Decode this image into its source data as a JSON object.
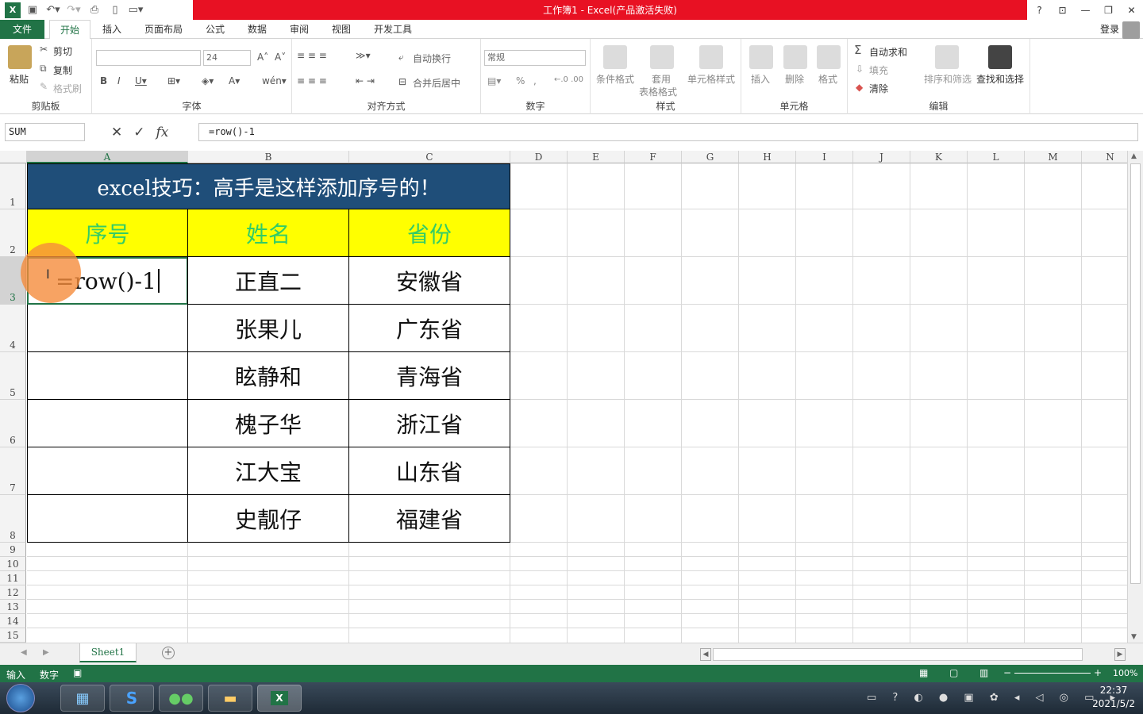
{
  "app": {
    "title": "工作簿1 - Excel(产品激活失败)"
  },
  "window": {
    "help": "?",
    "ribbon_display": "⊡",
    "minimize": "—",
    "restore": "❐",
    "close": "✕"
  },
  "tabs": [
    "文件",
    "开始",
    "插入",
    "页面布局",
    "公式",
    "数据",
    "审阅",
    "视图",
    "开发工具"
  ],
  "account": {
    "login": "登录"
  },
  "ribbon": {
    "clipboard": {
      "paste": "粘贴",
      "cut": "剪切",
      "copy": "复制",
      "format_painter": "格式刷",
      "label": "剪贴板"
    },
    "font": {
      "font_name": "",
      "font_size": "24",
      "label": "字体"
    },
    "alignment": {
      "wrap": "自动换行",
      "merge": "合并后居中",
      "label": "对齐方式"
    },
    "number": {
      "format": "常规",
      "label": "数字"
    },
    "styles": {
      "conditional": "条件格式",
      "table1": "套用",
      "table2": "表格格式",
      "cell_styles": "单元格样式",
      "label": "样式"
    },
    "cells": {
      "insert": "插入",
      "delete": "删除",
      "format": "格式",
      "label": "单元格"
    },
    "editing": {
      "autosum": "自动求和",
      "fill": "填充",
      "clear": "清除",
      "sort": "排序和筛选",
      "find": "查找和选择",
      "label": "编辑"
    }
  },
  "formula_bar": {
    "name_box": "SUM",
    "formula": "=row()-1",
    "fx": "fx"
  },
  "columns": [
    "A",
    "B",
    "C",
    "D",
    "E",
    "F",
    "G",
    "H",
    "I",
    "J",
    "K",
    "L",
    "M",
    "N"
  ],
  "rows": [
    "1",
    "2",
    "3",
    "4",
    "5",
    "6",
    "7",
    "8",
    "9",
    "10",
    "11",
    "12",
    "13",
    "14",
    "15"
  ],
  "table": {
    "title": "excel技巧：高手是这样添加序号的！",
    "headers": [
      "序号",
      "姓名",
      "省份"
    ],
    "editing_cell": "=row()-1",
    "names": [
      "正直二",
      "张果儿",
      "眩静和",
      "槐子华",
      "江大宝",
      "史靓仔"
    ],
    "provinces": [
      "安徽省",
      "广东省",
      "青海省",
      "浙江省",
      "山东省",
      "福建省"
    ]
  },
  "sheet_tabs": [
    "Sheet1"
  ],
  "status": {
    "mode": "输入",
    "num": "数字",
    "zoom": "100%"
  },
  "taskbar": {
    "time": "22:37",
    "date": "2021/5/2"
  },
  "colors": {
    "excel_green": "#217346",
    "title_red": "#e81123",
    "table_title_bg": "#1f4e79",
    "header_yellow": "#ffff00",
    "header_text": "#33cc66"
  }
}
